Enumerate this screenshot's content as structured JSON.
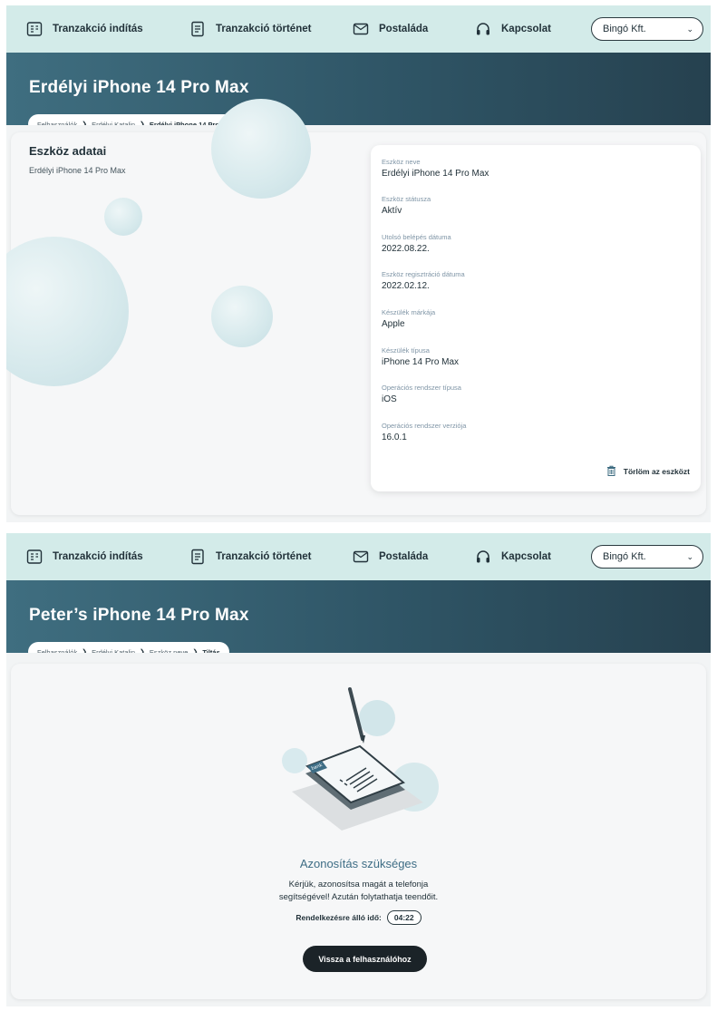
{
  "nav": {
    "items": [
      {
        "label": "Tranzakció indítás",
        "icon": "transaction-start-icon"
      },
      {
        "label": "Tranzakció történet",
        "icon": "transaction-history-icon"
      },
      {
        "label": "Postaláda",
        "icon": "mailbox-icon"
      },
      {
        "label": "Kapcsolat",
        "icon": "headset-icon"
      }
    ],
    "company_select": "Bingó Kft."
  },
  "screen1": {
    "title": "Erdélyi iPhone 14 Pro Max",
    "breadcrumb": [
      "Felhasználók",
      "Erdélyi Katalin",
      "Erdélyi iPhone 14 Pro Max"
    ],
    "section_title": "Eszköz adatai",
    "section_subtitle": "Erdélyi iPhone 14 Pro Max",
    "fields": [
      {
        "label": "Eszköz neve",
        "value": "Erdélyi iPhone 14 Pro Max"
      },
      {
        "label": "Eszköz státusza",
        "value": "Aktív"
      },
      {
        "label": "Utolsó belépés dátuma",
        "value": "2022.08.22."
      },
      {
        "label": "Eszköz regisztráció dátuma",
        "value": "2022.02.12."
      },
      {
        "label": "Készülék márkája",
        "value": "Apple"
      },
      {
        "label": "Készülék típusa",
        "value": "iPhone 14 Pro Max"
      },
      {
        "label": "Operációs rendszer típusa",
        "value": "iOS"
      },
      {
        "label": "Operációs rendszer verziója",
        "value": "16.0.1"
      }
    ],
    "delete_label": "Törlöm az eszközt"
  },
  "screen2": {
    "title": "Peter’s iPhone 14 Pro Max",
    "breadcrumb": [
      "Felhasználók",
      "Erdélyi Katalin",
      "Eszköz neve",
      "Tiltás"
    ],
    "illustration_label": "bank",
    "auth_title": "Azonosítás szükséges",
    "auth_text_line1": "Kérjük, azonosítsa magát a telefonja",
    "auth_text_line2": "segítségével! Azután folytathatja teendőit.",
    "timer_label": "Rendelkezésre álló idő:",
    "timer_value": "04:22",
    "back_button": "Vissza a felhasználóhoz"
  },
  "colors": {
    "nav_bg": "#d3ebe9",
    "hero_start": "#3f6e80",
    "hero_end": "#26414f",
    "accent": "#3e6d85",
    "button_dark": "#1b2328"
  }
}
